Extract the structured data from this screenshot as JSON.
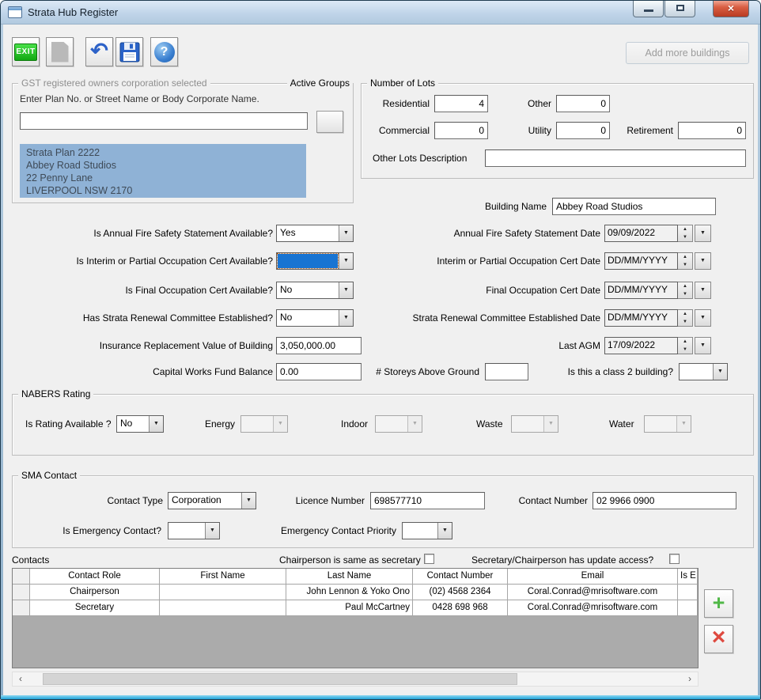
{
  "window": {
    "title": "Strata Hub Register"
  },
  "icons": {
    "combo_arrow": "▼",
    "spin_up": "▲",
    "spin_down": "▼",
    "undo": "↶",
    "help": "?",
    "exit": "EXIT",
    "close": "×",
    "plus": "+",
    "delete": "×",
    "scroll_left": "‹",
    "scroll_right": "›"
  },
  "toolbar": {
    "add_buildings_label": "Add more buildings"
  },
  "gst": {
    "title": "GST registered owners corporation selected",
    "active_groups_label": "Active Groups",
    "prompt": "Enter Plan No. or Street Name or Body Corporate Name.",
    "search_value": "",
    "selection": [
      "Strata Plan 2222",
      "Abbey Road Studios",
      "22 Penny Lane",
      "LIVERPOOL NSW 2170"
    ]
  },
  "lots": {
    "title": "Number of Lots",
    "residential_label": "Residential",
    "residential": "4",
    "other_label": "Other",
    "other": "0",
    "commercial_label": "Commercial",
    "commercial": "0",
    "utility_label": "Utility",
    "utility": "0",
    "retirement_label": "Retirement",
    "retirement": "0",
    "other_desc_label": "Other Lots Description",
    "other_desc": ""
  },
  "building": {
    "name_label": "Building Name",
    "name": "Abbey Road Studios"
  },
  "form": {
    "fire_q": "Is Annual Fire Safety Statement Available?",
    "fire_a": "Yes",
    "interim_q": "Is Interim or Partial Occupation Cert Available?",
    "interim_a": "",
    "final_q": "Is Final Occupation Cert Available?",
    "final_a": "No",
    "renewal_q": "Has Strata Renewal Committee Established?",
    "renewal_a": "No",
    "insurance_label": "Insurance Replacement Value of Building",
    "insurance_value": "3,050,000.00",
    "capital_label": "Capital Works Fund Balance",
    "capital_value": "0.00",
    "fire_date_label": "Annual Fire Safety Statement Date",
    "fire_date": "09/09/2022",
    "interim_date_label": "Interim or Partial Occupation Cert Date",
    "interim_date": "DD/MM/YYYY",
    "final_date_label": "Final Occupation Cert Date",
    "final_date": "DD/MM/YYYY",
    "renewal_date_label": "Strata Renewal Committee Established Date",
    "renewal_date": "DD/MM/YYYY",
    "agm_label": "Last AGM",
    "agm_date": "17/09/2022",
    "storeys_label": "# Storeys Above Ground",
    "storeys_value": "",
    "class2_label": "Is this a class 2 building?",
    "class2_value": ""
  },
  "nabers": {
    "title": "NABERS Rating",
    "available_label": "Is Rating Available ?",
    "available": "No",
    "energy_label": "Energy",
    "energy": "",
    "indoor_label": "Indoor",
    "indoor": "",
    "waste_label": "Waste",
    "waste": "",
    "water_label": "Water",
    "water": ""
  },
  "sma": {
    "title": "SMA Contact",
    "contact_type_label": "Contact Type",
    "contact_type": "Corporation",
    "licence_label": "Licence Number",
    "licence": "698577710",
    "number_label": "Contact Number",
    "number": "02 9966 0900",
    "emergency_label": "Is Emergency Contact?",
    "emergency": "",
    "priority_label": "Emergency Contact Priority",
    "priority": ""
  },
  "contacts": {
    "label": "Contacts",
    "same_label": "Chairperson is same as secretary",
    "access_label": "Secretary/Chairperson has update access?",
    "table": {
      "columns": [
        "",
        "Contact Role",
        "First Name",
        "Last Name",
        "Contact Number",
        "Email",
        "Is E"
      ],
      "rows": [
        {
          "role": "Chairperson",
          "first": "",
          "last": "John Lennon & Yoko Ono",
          "phone": "(02) 4568 2364",
          "email": "Coral.Conrad@mrisoftware.com",
          "extra": ""
        },
        {
          "role": "Secretary",
          "first": "",
          "last": "Paul McCartney",
          "phone": "0428 698 968",
          "email": "Coral.Conrad@mrisoftware.com",
          "extra": ""
        }
      ]
    }
  }
}
